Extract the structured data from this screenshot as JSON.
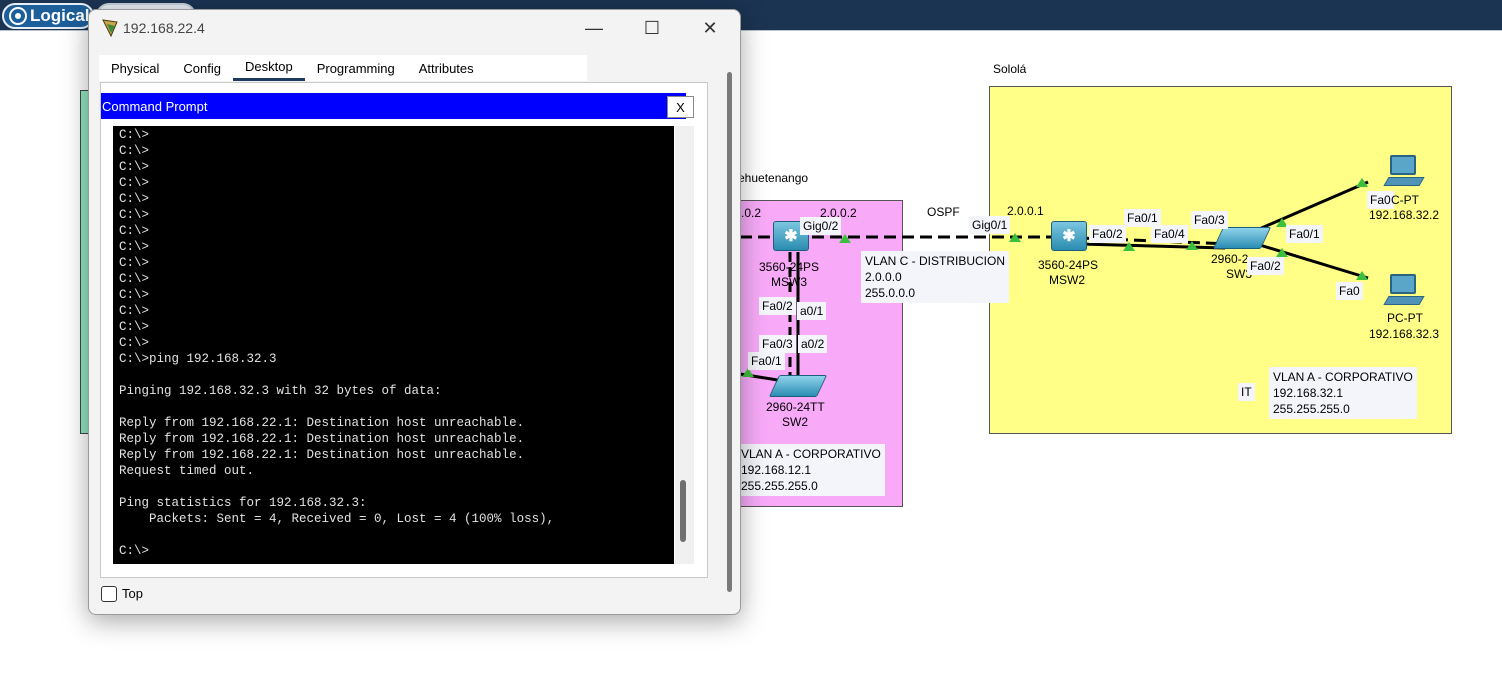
{
  "app": {
    "tab_logical": "Logical",
    "tab_physical": ""
  },
  "diagram": {
    "areas": {
      "huehuetenango": "ehuetenango",
      "solola": "Sololá"
    },
    "ospf_label": "OSPF",
    "labels": {
      "ip_left": ".0.2",
      "ip_mid": "2.0.0.2",
      "ip_right": "2.0.0.1",
      "gig02": "Gig0/2",
      "gig01": "Gig0/1",
      "msw3_model": "3560-24PS",
      "msw3_name": "MSW3",
      "msw2_model": "3560-24PS",
      "msw2_name": "MSW2",
      "sw2_model": "2960-24TT",
      "sw2_name": "SW2",
      "sw3_model": "2960-2",
      "sw3_name": "SW3",
      "p_fa02_a": "Fa0/2",
      "p_fa01_a": "a0/1",
      "p_fa03_a": "Fa0/3",
      "p_fa02_b": "a0/2",
      "p_fa01_b": "Fa0/1",
      "y_fa02": "Fa0/2",
      "y_fa01": "Fa0/1",
      "y_fa04": "Fa0/4",
      "y_fa03": "Fa0/3",
      "y_fa01_b": "Fa0/1",
      "y_fa02_b": "Fa0/2",
      "pc1_port": "Fa0",
      "pc1_model": "C-PT",
      "pc1_ip": "192.168.32.2",
      "pc2_port": "Fa0",
      "pc2_model": "PC-PT",
      "pc2_ip": "192.168.32.3",
      "it": "IT"
    },
    "notes": {
      "vlan_c": [
        "VLAN C - DISTRIBUCION",
        "2.0.0.0",
        "255.0.0.0"
      ],
      "vlan_a_pink": [
        "VLAN A - CORPORATIVO",
        "192.168.12.1",
        "255.255.255.0"
      ],
      "vlan_a_yellow": [
        "VLAN A - CORPORATIVO",
        "192.168.32.1",
        "255.255.255.0"
      ]
    }
  },
  "window": {
    "title": "192.168.22.4",
    "controls": {
      "minimize": "—",
      "maximize": "☐",
      "close": "✕"
    },
    "tabs": [
      "Physical",
      "Config",
      "Desktop",
      "Programming",
      "Attributes"
    ],
    "active_tab": "Desktop",
    "cmd_title": "Command Prompt",
    "cmd_close": "X",
    "terminal_lines": [
      "C:\\>",
      "C:\\>",
      "C:\\>",
      "C:\\>",
      "C:\\>",
      "C:\\>",
      "C:\\>",
      "C:\\>",
      "C:\\>",
      "C:\\>",
      "C:\\>",
      "C:\\>",
      "C:\\>",
      "C:\\>",
      "C:\\>ping 192.168.32.3",
      "",
      "Pinging 192.168.32.3 with 32 bytes of data:",
      "",
      "Reply from 192.168.22.1: Destination host unreachable.",
      "Reply from 192.168.22.1: Destination host unreachable.",
      "Reply from 192.168.22.1: Destination host unreachable.",
      "Request timed out.",
      "",
      "Ping statistics for 192.168.32.3:",
      "    Packets: Sent = 4, Received = 0, Lost = 4 (100% loss),",
      "",
      "C:\\>"
    ],
    "top_label": "Top",
    "top_checked": false
  },
  "colors": {
    "topbar": "#1b3452",
    "cmd_title_bg": "#0000ff",
    "area_pink": "#f8aaf8",
    "area_yellow": "#ffff88",
    "area_green": "#8ee8c0",
    "link_port": "#3cbf3c"
  }
}
